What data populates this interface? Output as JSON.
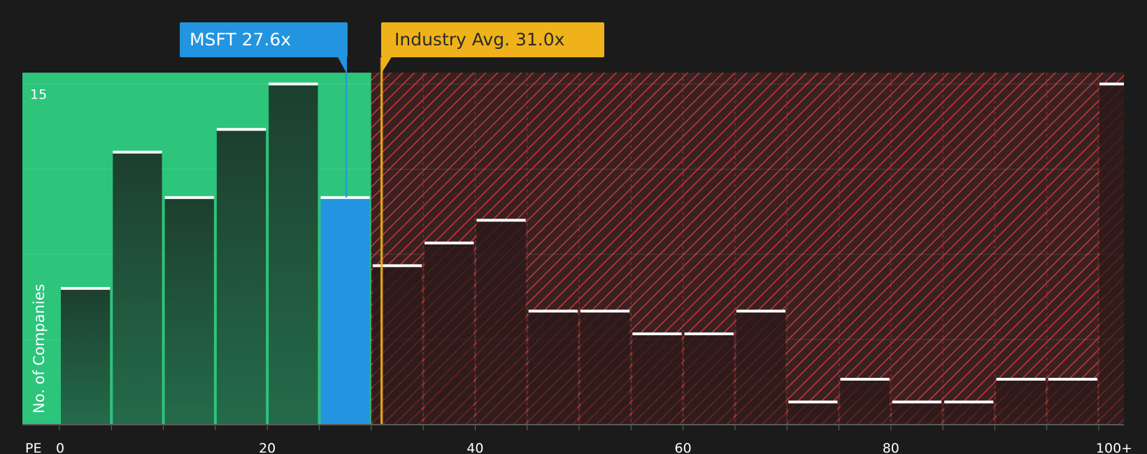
{
  "chart_data": {
    "type": "bar",
    "x_axis_label": "PE",
    "y_axis_label": "No. of Companies",
    "x_ticks": [
      "0",
      "20",
      "40",
      "60",
      "80",
      "100+"
    ],
    "y_ticks": [
      "15"
    ],
    "bin_width": 5,
    "bins": [
      {
        "start": 0,
        "end": 5,
        "value": 6
      },
      {
        "start": 5,
        "end": 10,
        "value": 12
      },
      {
        "start": 10,
        "end": 15,
        "value": 10
      },
      {
        "start": 15,
        "end": 20,
        "value": 13
      },
      {
        "start": 20,
        "end": 25,
        "value": 15
      },
      {
        "start": 25,
        "end": 30,
        "value": 10,
        "highlight": true
      },
      {
        "start": 30,
        "end": 35,
        "value": 7
      },
      {
        "start": 35,
        "end": 40,
        "value": 8
      },
      {
        "start": 40,
        "end": 45,
        "value": 9
      },
      {
        "start": 45,
        "end": 50,
        "value": 5
      },
      {
        "start": 50,
        "end": 55,
        "value": 5
      },
      {
        "start": 55,
        "end": 60,
        "value": 4
      },
      {
        "start": 60,
        "end": 65,
        "value": 4
      },
      {
        "start": 65,
        "end": 70,
        "value": 5
      },
      {
        "start": 70,
        "end": 75,
        "value": 1
      },
      {
        "start": 75,
        "end": 80,
        "value": 2
      },
      {
        "start": 80,
        "end": 85,
        "value": 1
      },
      {
        "start": 85,
        "end": 90,
        "value": 1
      },
      {
        "start": 90,
        "end": 95,
        "value": 2
      },
      {
        "start": 95,
        "end": 100,
        "value": 2
      },
      {
        "start": 100,
        "end": null,
        "value": 15,
        "label": "100+"
      }
    ],
    "ylim": [
      0,
      15.5
    ],
    "fair_range": [
      0,
      30
    ],
    "markers": [
      {
        "name": "MSFT",
        "value": 27.6,
        "label": "MSFT 27.6x",
        "color": "#2294e0"
      },
      {
        "name": "Industry Avg.",
        "value": 31.0,
        "label": "Industry Avg. 31.0x",
        "color": "#efb21a"
      }
    ],
    "grid": true
  },
  "colors": {
    "background": "#1b1b1b",
    "fair_zone": "#2dc47c",
    "overvalued_zone": "#3a2020",
    "hatch": "#c63b3b",
    "bar_dark": "#1f4a36",
    "highlight_bar": "#2294e0",
    "industry_line": "#efb21a"
  }
}
